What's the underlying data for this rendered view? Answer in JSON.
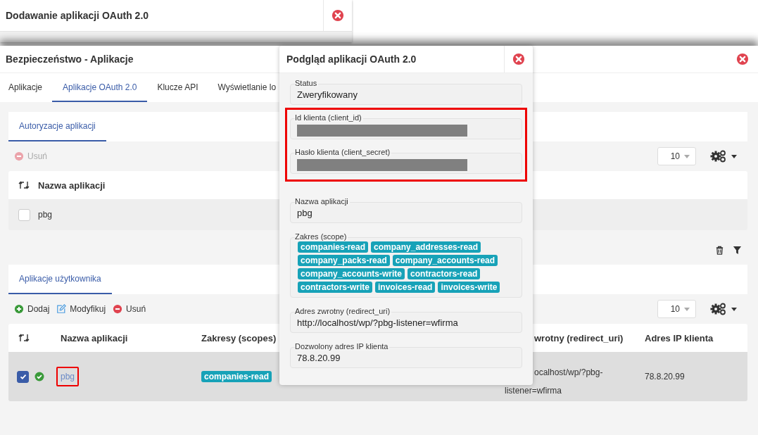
{
  "background_window": {
    "title": "Dodawanie aplikacji OAuth 2.0"
  },
  "window": {
    "title": "Bezpieczeństwo - Aplikacje"
  },
  "tabs": [
    {
      "label": "Aplikacje",
      "selected": false
    },
    {
      "label": "Aplikacje OAuth 2.0",
      "selected": true
    },
    {
      "label": "Klucze API",
      "selected": false
    },
    {
      "label": "Wyświetlanie lo",
      "selected": false
    }
  ],
  "authorizations": {
    "tab": {
      "label": "Autoryzacje aplikacji",
      "selected": true
    },
    "toolbar": [
      {
        "kind": "delete",
        "label": "Usuń",
        "disabled": true
      }
    ],
    "page_size": "10",
    "columns": [
      "Nazwa aplikacji"
    ],
    "rows": [
      {
        "checked": false,
        "name": "pbg"
      }
    ]
  },
  "user_apps": {
    "tab": {
      "label": "Aplikacje użytkownika",
      "selected": true
    },
    "toolbar": [
      {
        "kind": "add",
        "label": "Dodaj",
        "disabled": false
      },
      {
        "kind": "edit",
        "label": "Modyfikuj",
        "disabled": false
      },
      {
        "kind": "delete",
        "label": "Usuń",
        "disabled": false
      }
    ],
    "page_size": "10",
    "columns": [
      "Nazwa aplikacji",
      "Zakresy (scopes)",
      "wrotny (redirect_uri)",
      "Adres IP klienta"
    ],
    "rows": [
      {
        "checked": true,
        "verified": true,
        "name": "pbg",
        "highlighted": true,
        "scopes": [
          "companies-read"
        ],
        "redirect_lines": [
          "ocalhost/wp/?pbg-",
          "listener=wfirma"
        ],
        "ip": "78.8.20.99"
      }
    ]
  },
  "modal": {
    "title": "Podgląd aplikacji OAuth 2.0",
    "groups": [
      {
        "highlighted": false,
        "fields": [
          {
            "kind": "text",
            "label": "Status",
            "value": "Zweryfikowany"
          }
        ]
      },
      {
        "highlighted": true,
        "fields": [
          {
            "kind": "redacted",
            "label": "Id klienta (client_id)"
          },
          {
            "kind": "redacted",
            "label": "Hasło klienta (client_secret)"
          }
        ]
      },
      {
        "highlighted": false,
        "fields": [
          {
            "kind": "text",
            "label": "Nazwa aplikacji",
            "value": "pbg"
          },
          {
            "kind": "tags",
            "label": "Zakres (scope)",
            "tags": [
              "companies-read",
              "company_addresses-read",
              "company_packs-read",
              "company_accounts-read",
              "company_accounts-write",
              "contractors-read",
              "contractors-write",
              "invoices-read",
              "invoices-write"
            ]
          },
          {
            "kind": "text",
            "label": "Adres zwrotny (redirect_uri)",
            "value": "http://localhost/wp/?pbg-listener=wfirma"
          },
          {
            "kind": "text",
            "label": "Dozwolony adres IP klienta",
            "value": "78.8.20.99"
          }
        ]
      }
    ]
  }
}
